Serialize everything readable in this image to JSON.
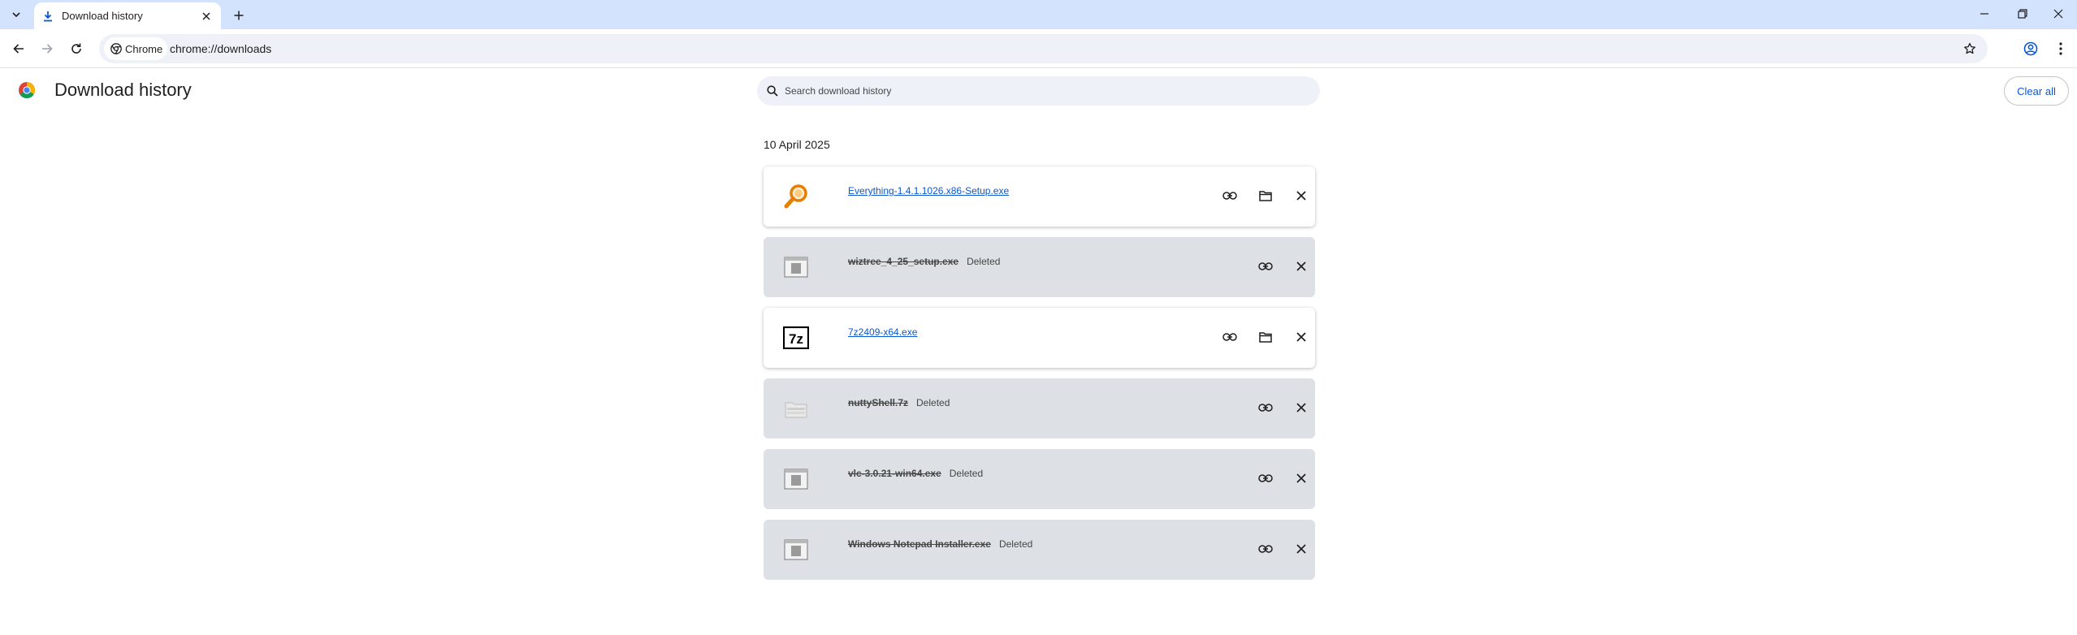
{
  "browser": {
    "tab_title": "Download history",
    "site_chip_label": "Chrome",
    "url": "chrome://downloads"
  },
  "page": {
    "title": "Download history",
    "search_placeholder": "Search download history",
    "clear_all_label": "Clear all",
    "date_heading": "10 April 2025"
  },
  "downloads": [
    {
      "name": "Everything-1.4.1.1026.x86-Setup.exe",
      "status": "",
      "state": "active",
      "icon": "magnifier-icon"
    },
    {
      "name": "wiztree_4_25_setup.exe",
      "status": "Deleted",
      "state": "deleted",
      "icon": "generic-exe-icon"
    },
    {
      "name": "7z2409-x64.exe",
      "status": "",
      "state": "active",
      "icon": "7zip-icon"
    },
    {
      "name": "nuttyShell.7z",
      "status": "Deleted",
      "state": "deleted",
      "icon": "archive-file-icon"
    },
    {
      "name": "vlc-3.0.21-win64.exe",
      "status": "Deleted",
      "state": "deleted",
      "icon": "generic-exe-icon"
    },
    {
      "name": "Windows Notepad Installer.exe",
      "status": "Deleted",
      "state": "deleted",
      "icon": "generic-exe-icon"
    }
  ],
  "colors": {
    "tabstrip": "#d3e3fd",
    "link": "#0b57d0",
    "deleted_card": "#dde0e5",
    "omnibox": "#eef1f8"
  }
}
